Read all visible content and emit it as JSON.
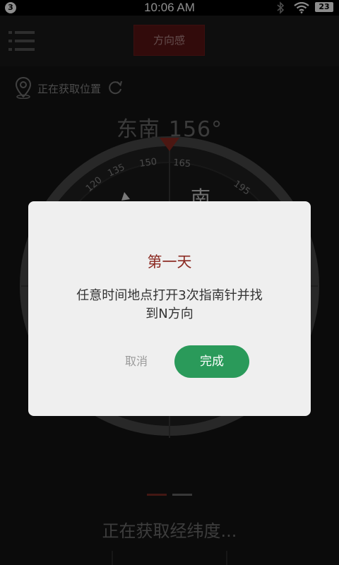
{
  "status_bar": {
    "notification_count": "3",
    "time": "10:06 AM",
    "battery": "23"
  },
  "header": {
    "title": "方向感"
  },
  "location": {
    "status_text": "正在获取位置"
  },
  "heading": {
    "direction": "东南",
    "degrees": "156°"
  },
  "compass": {
    "tick_labels": [
      "120",
      "135",
      "150",
      "165",
      "195"
    ],
    "cardinal_visible": "南"
  },
  "bottom": {
    "latlon_text": "正在获取经纬度..."
  },
  "dialog": {
    "title": "第一天",
    "message_line1": "任意时间地点打开3次指南针并找",
    "message_line2": "到N方向",
    "cancel_label": "取消",
    "done_label": "完成"
  },
  "colors": {
    "accent_red": "#8b2a22",
    "confirm_green": "#2a9a5a",
    "pager_active": "#8b2a22"
  }
}
